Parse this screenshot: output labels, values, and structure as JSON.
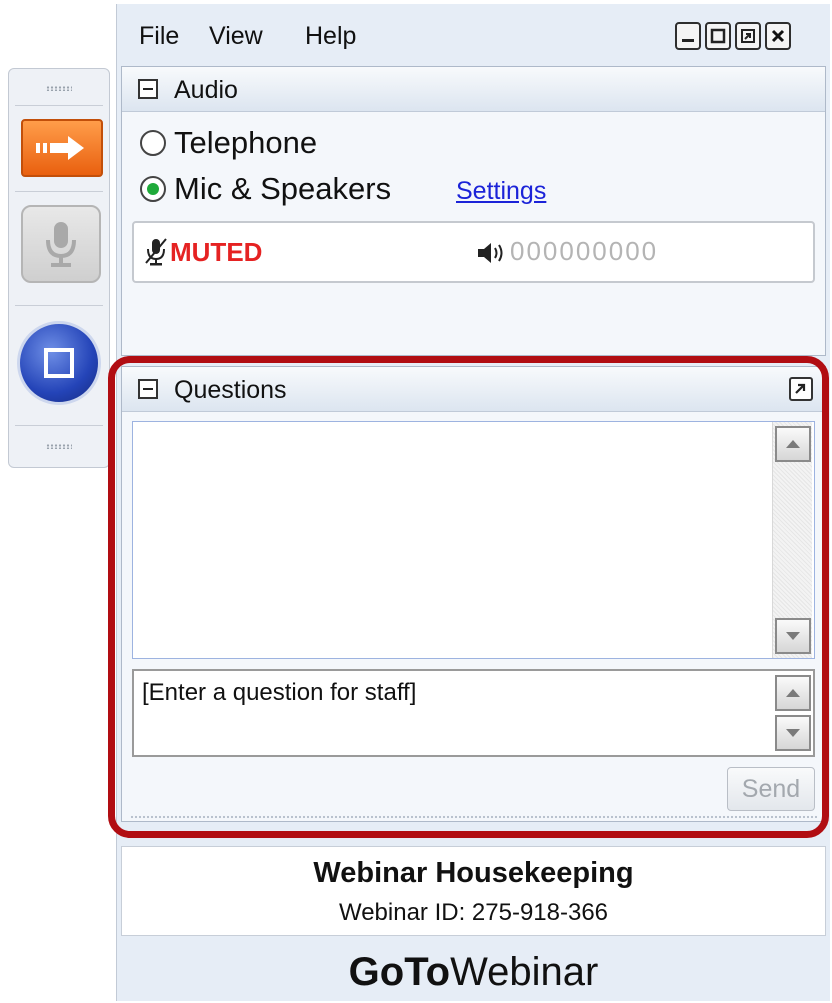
{
  "menu": {
    "file": "File",
    "view": "View",
    "help": "Help"
  },
  "window_controls": [
    "minimize",
    "maximize",
    "restore",
    "close"
  ],
  "audio": {
    "title": "Audio",
    "options": [
      {
        "label": "Telephone",
        "selected": false
      },
      {
        "label": "Mic & Speakers",
        "selected": true
      }
    ],
    "settings_link": "Settings",
    "status": "MUTED",
    "level_meter": "000000000"
  },
  "questions": {
    "title": "Questions",
    "input_placeholder": "[Enter a question for staff]",
    "send_label": "Send"
  },
  "footer": {
    "title": "Webinar Housekeeping",
    "webinar_id": "Webinar ID: 275-918-366",
    "brand_bold": "GoTo",
    "brand_regular": "Webinar"
  },
  "colors": {
    "accent_orange": "#e9600f",
    "muted_red": "#e52222",
    "link_blue": "#1b23d8",
    "highlight_red": "#b10d12",
    "radio_green": "#1faa3a"
  },
  "icons": [
    "show-hide-arrow-icon",
    "microphone-icon",
    "screen-share-icon",
    "speaker-icon",
    "popout-icon"
  ]
}
